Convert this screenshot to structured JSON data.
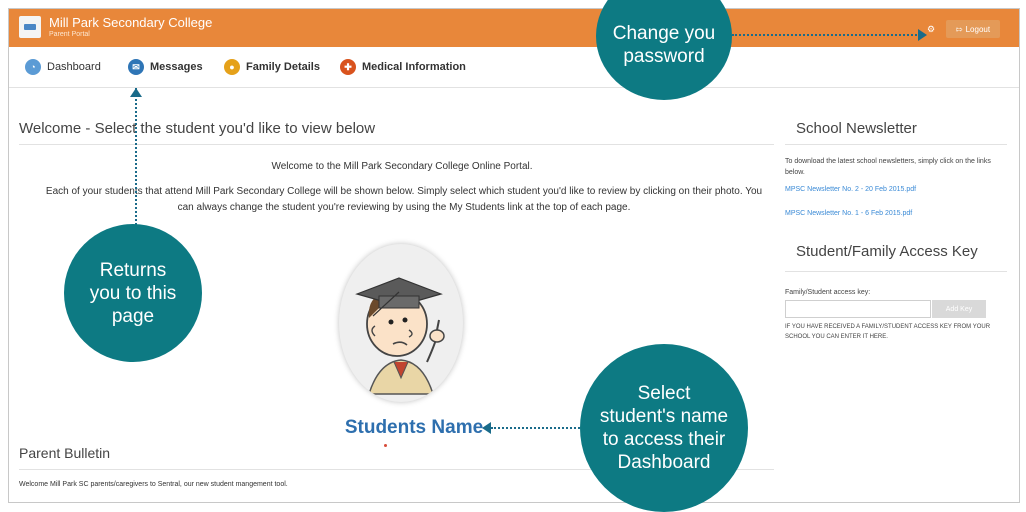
{
  "header": {
    "school_name": "Mill Park Secondary College",
    "portal_subtitle": "Parent Portal",
    "logout_label": "Logout",
    "settings_icon": "gear-icon",
    "logout_icon": "logout-icon",
    "bar_color": "#e8873a"
  },
  "nav": {
    "items": [
      {
        "label": "Dashboard",
        "icon": "dashboard-icon",
        "color": "#5b9bd5"
      },
      {
        "label": "Messages",
        "icon": "envelope-icon",
        "color": "#2e75b6"
      },
      {
        "label": "Family Details",
        "icon": "family-icon",
        "color": "#e5a11a"
      },
      {
        "label": "Medical Information",
        "icon": "medical-icon",
        "color": "#d9531e"
      }
    ]
  },
  "main": {
    "title": "Welcome - Select the student you'd like to view below",
    "welcome": "Welcome to the Mill Park Secondary College Online Portal.",
    "intro": "Each of your students that attend Mill Park Secondary College will be shown below. Simply select which student you'd like to review by clicking on their photo. You can always change the student you're reviewing by using the My Students link at the top of each page.",
    "student_name": "Students Name"
  },
  "bulletin": {
    "title": "Parent Bulletin",
    "text": "Welcome Mill Park SC parents/caregivers to Sentral, our new student mangement tool."
  },
  "sidebar": {
    "newsletter_title": "School Newsletter",
    "newsletter_text": "To download the latest school newsletters, simply click on the links below.",
    "newsletters": [
      "MPSC Newsletter No. 2 - 20 Feb 2015.pdf",
      "MPSC Newsletter No. 1 - 6 Feb 2015.pdf"
    ],
    "access_title": "Student/Family Access Key",
    "access_label": "Family/Student access key:",
    "access_button": "Add Key",
    "access_note": "IF YOU HAVE RECEIVED A FAMILY/STUDENT ACCESS KEY FROM YOUR SCHOOL YOU CAN ENTER IT HERE."
  },
  "callouts": {
    "password": "Change you password",
    "returns": "Returns you to this page",
    "select": "Select student's name to access their Dashboard",
    "color": "#0d7a83"
  }
}
